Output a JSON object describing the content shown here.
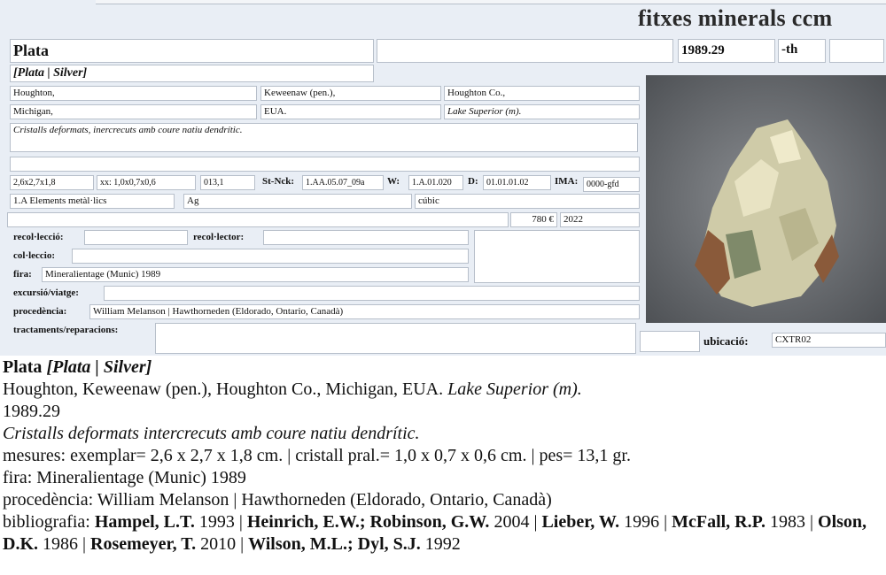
{
  "brand": "fitxes minerals ccm",
  "card": {
    "name": "Plata",
    "blank_1": "",
    "catalog_no": "1989.29",
    "suffix": "-th",
    "blank_2": "",
    "synonyms": "[Plata | Silver]",
    "locality": {
      "town": "Houghton,",
      "county": "Keweenaw (pen.),",
      "district": "Houghton Co.,",
      "state": "Michigan,",
      "country": "EUA.",
      "region": "Lake Superior (m)."
    },
    "description": "Cristalls deformats, inercrecuts amb  coure natiu dendrític.",
    "notes_line": "",
    "size": "2,6x2,7x1,8",
    "crystal": "xx: 1,0x0,7x0,6",
    "weight": "013,1",
    "stnck_label": "St-Nck:",
    "stnck": "1.AA.05.07_09a",
    "w_label": "W:",
    "w_value": "1.A.01.020",
    "d_label": "D:",
    "d_value": "01.01.01.02",
    "ima_label": "IMA:",
    "ima_value": "0000-gfd",
    "class": "1.A Elements metàl·lics",
    "formula": "Ag",
    "system": "cúbic",
    "misc_blank": "",
    "price": "780 €",
    "year": "2022",
    "recol_leccio_label": "recol·lecció:",
    "recol_leccio": "",
    "recol_lector_label": "recol·lector:",
    "recol_lector": "",
    "collection_label": "col·leccio:",
    "collection": "",
    "fair_label": "fira:",
    "fair": "Mineralientage (Munic) 1989",
    "excursion_label": "excursió/viatge:",
    "excursion": "",
    "provenance_label": "procedència:",
    "provenance": "William Melanson | Hawthorneden (Eldorado, Ontario, Canadà)",
    "treatments_label": "tractaments/reparacions:",
    "treatments": "",
    "location_blank": "",
    "location_label": "ubicació:",
    "location": "CXTR02"
  },
  "report": {
    "name": "Plata",
    "synonyms": "[Plata | Silver]",
    "locality_plain": "Houghton, Keweenaw (pen.), Houghton Co., Michigan, EUA. ",
    "locality_region": "Lake Superior (m).",
    "catalog": "1989.29",
    "description": "Cristalls deformats intercrecuts amb coure natiu dendrític.",
    "measures": "mesures: exemplar= 2,6 x 2,7 x 1,8 cm. | cristall pral.= 1,0 x 0,7 x 0,6 cm. | pes= 13,1 gr.",
    "fair": "fira: Mineralientage (Munic) 1989",
    "provenance": "procedència: William Melanson | Hawthorneden (Eldorado, Ontario, Canadà)",
    "biblio_label": "bibliografia: ",
    "bibliography": [
      {
        "author": "Hampel, L.T.",
        "year": " 1993",
        "sep": " | "
      },
      {
        "author": "Heinrich, E.W.; Robinson, G.W.",
        "year": " 2004",
        "sep": " | "
      },
      {
        "author": "Lieber, W.",
        "year": " 1996",
        "sep": " | "
      },
      {
        "author": "McFall, R.P.",
        "year": " 1983",
        "sep": " | "
      },
      {
        "author": "Olson, D.K.",
        "year": " 1986",
        "sep": " | "
      },
      {
        "author": "Rosemeyer, T.",
        "year": " 2010",
        "sep": " | "
      },
      {
        "author": "Wilson, M.L.; Dyl, S.J.",
        "year": " 1992",
        "sep": ""
      }
    ]
  },
  "colors": {
    "form_bg": "#e9eef5",
    "field_border": "#b7bfca",
    "photo_bg": "#6f7276",
    "silver": "#cfcba8",
    "copper": "#8a5a3a"
  },
  "icons": {
    "photo": "silver-specimen-photo"
  }
}
